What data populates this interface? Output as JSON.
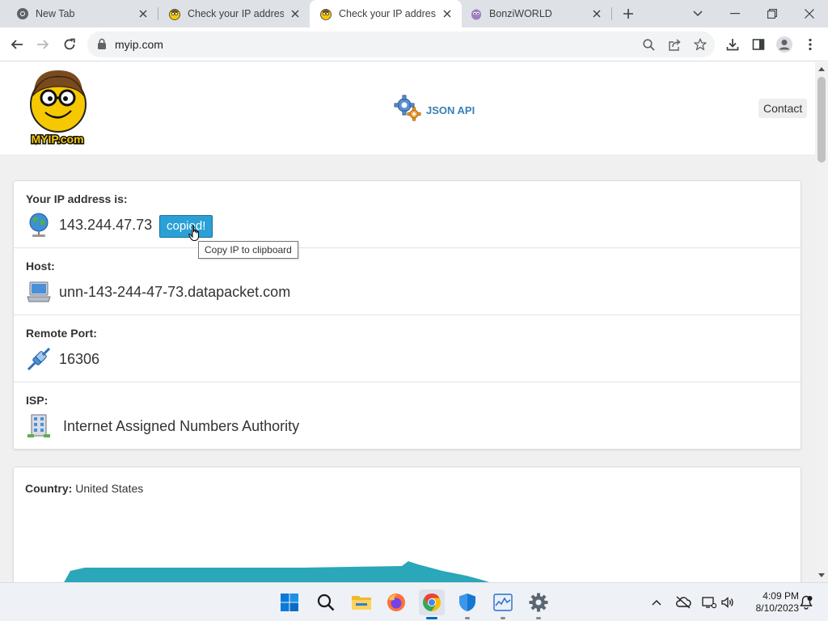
{
  "browser": {
    "tabs": [
      {
        "title": "New Tab",
        "favicon": "chrome-icon",
        "active": false
      },
      {
        "title": "Check your IP address |",
        "favicon": "myip-icon",
        "active": false
      },
      {
        "title": "Check your IP address",
        "favicon": "myip-icon",
        "active": true
      },
      {
        "title": "BonziWORLD",
        "favicon": "bonziworld-icon",
        "active": false
      }
    ],
    "url": "myip.com"
  },
  "site": {
    "logo_text": "MYIP.com",
    "json_api_label": "JSON API",
    "contact_label": "Contact"
  },
  "info": {
    "ip": {
      "label": "Your IP address is:",
      "value": "143.244.47.73",
      "button": "copied!",
      "tooltip": "Copy IP to clipboard"
    },
    "host": {
      "label": "Host:",
      "value": "unn-143-244-47-73.datapacket.com"
    },
    "port": {
      "label": "Remote Port:",
      "value": "16306"
    },
    "isp": {
      "label": "ISP:",
      "value": "Internet Assigned Numbers Authority"
    }
  },
  "country": {
    "label": "Country:",
    "value": "United States"
  },
  "colors": {
    "accent": "#2aa0d6",
    "link": "#3a7fb5",
    "map": "#2aa7b9"
  },
  "taskbar": {
    "apps": [
      "start-icon",
      "search-icon",
      "file-explorer-icon",
      "firefox-icon",
      "chrome-icon",
      "windows-security-icon",
      "task-manager-icon",
      "settings-icon"
    ],
    "clock": {
      "time": "4:09 PM",
      "date": "8/10/2023"
    }
  }
}
